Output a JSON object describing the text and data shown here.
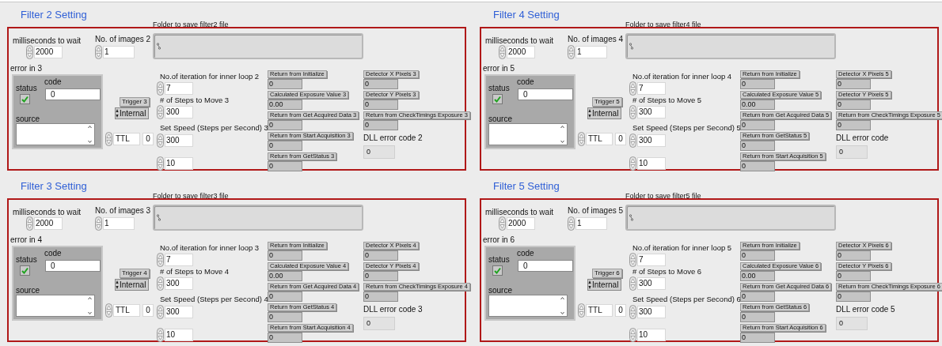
{
  "panels": [
    {
      "title": "Filter 2 Setting",
      "folder": {
        "label": "Folder to save filter2 file"
      },
      "wait": {
        "label": "milliseconds to wait",
        "value": "2000"
      },
      "images": {
        "label": "No. of images 2",
        "value": "1"
      },
      "error": {
        "label": "error in 3",
        "status_label": "status",
        "status": true,
        "code_label": "code",
        "code": "0",
        "source_label": "source"
      },
      "trigger": {
        "label": "Trigger 3",
        "value": "Internal"
      },
      "ttl": {
        "value": "TTL",
        "number": "0"
      },
      "iterations": {
        "label": "No.of iteration for inner loop 2",
        "value": "7"
      },
      "steps": {
        "label": "# of Steps to Move 3",
        "value": "300"
      },
      "speed": {
        "label": "Set Speed (Steps per Second) 3",
        "value": "300"
      },
      "extra": {
        "value": "10"
      },
      "indicators_left": [
        {
          "label": "Return from Initialize",
          "value": "0"
        },
        {
          "label": "Calculated Exposure Value 3",
          "value": "0.00"
        },
        {
          "label": "Return  from Get Acquired Data 3",
          "value": "0"
        },
        {
          "label": "Return from Start Acquisition 3",
          "value": "0"
        },
        {
          "label": "Return from GetStatus 3",
          "value": "0"
        }
      ],
      "indicators_right": [
        {
          "kind": "tag",
          "label": "Detector X Pixels 3",
          "value": "0"
        },
        {
          "kind": "tag",
          "label": "Detector Y Pixels 3",
          "value": "0"
        },
        {
          "kind": "tag",
          "label": "Return from CheckTimings Exposure 3",
          "value": "0"
        },
        {
          "kind": "plain",
          "label": "DLL error code 2",
          "value": "0"
        }
      ]
    },
    {
      "title": "Filter 3 Setting",
      "folder": {
        "label": "Folder to save filter3 file"
      },
      "wait": {
        "label": "milliseconds to wait",
        "value": "2000"
      },
      "images": {
        "label": "No. of images 3",
        "value": "1"
      },
      "error": {
        "label": "error in 4",
        "status_label": "status",
        "status": true,
        "code_label": "code",
        "code": "0",
        "source_label": "source"
      },
      "trigger": {
        "label": "Trigger 4",
        "value": "Internal"
      },
      "ttl": {
        "value": "TTL",
        "number": "0"
      },
      "iterations": {
        "label": "No.of iteration for inner loop 3",
        "value": "7"
      },
      "steps": {
        "label": "# of Steps to Move 4",
        "value": "300"
      },
      "speed": {
        "label": "Set Speed (Steps per Second) 4",
        "value": "300"
      },
      "extra": {
        "value": "10"
      },
      "indicators_left": [
        {
          "label": "Return from Initialize",
          "value": "0"
        },
        {
          "label": "Calculated Exposure Value 4",
          "value": "0.00"
        },
        {
          "label": "Return  from Get Acquired Data 4",
          "value": "0"
        },
        {
          "label": "Return from GetStatus 4",
          "value": "0"
        },
        {
          "label": "Return from Start Acquisition 4",
          "value": "0"
        }
      ],
      "indicators_right": [
        {
          "kind": "tag",
          "label": "Detector X Pixels 4",
          "value": "0"
        },
        {
          "kind": "tag",
          "label": "Detector Y Pixels 4",
          "value": "0"
        },
        {
          "kind": "tag",
          "label": "Return from CheckTimings Exposure 4",
          "value": "0"
        },
        {
          "kind": "plain",
          "label": "DLL error code 3",
          "value": "0"
        }
      ]
    },
    {
      "title": "Filter 4 Setting",
      "folder": {
        "label": "Folder to save filter4 file"
      },
      "wait": {
        "label": "milliseconds to wait",
        "value": "2000"
      },
      "images": {
        "label": "No. of images 4",
        "value": "1"
      },
      "error": {
        "label": "error in 5",
        "status_label": "status",
        "status": true,
        "code_label": "code",
        "code": "0",
        "source_label": "source"
      },
      "trigger": {
        "label": "Trigger 5",
        "value": "Internal"
      },
      "ttl": {
        "value": "TTL",
        "number": "0"
      },
      "iterations": {
        "label": "No.of iteration for inner loop 4",
        "value": "7"
      },
      "steps": {
        "label": "# of Steps to Move 5",
        "value": "300"
      },
      "speed": {
        "label": "Set Speed (Steps per Second) 5",
        "value": "300"
      },
      "extra": {
        "value": "10"
      },
      "indicators_left": [
        {
          "label": "Return from Initialize",
          "value": "0"
        },
        {
          "label": "Calculated Exposure Value 5",
          "value": "0.00"
        },
        {
          "label": "Return  from Get Acquired Data 5",
          "value": "0"
        },
        {
          "label": "Return from GetStatus 5",
          "value": "0"
        },
        {
          "label": "Return from Start Acquisition 5",
          "value": "0"
        }
      ],
      "indicators_right": [
        {
          "kind": "tag",
          "label": "Detector X Pixels 5",
          "value": "0"
        },
        {
          "kind": "tag",
          "label": "Detector Y Pixels 5",
          "value": "0"
        },
        {
          "kind": "tag",
          "label": "Return from CheckTimings Exposure 5",
          "value": "0"
        },
        {
          "kind": "plain",
          "label": "DLL error code",
          "value": "0"
        }
      ]
    },
    {
      "title": "Filter 5 Setting",
      "folder": {
        "label": "Folder to save filter5 file"
      },
      "wait": {
        "label": "milliseconds to wait",
        "value": "2000"
      },
      "images": {
        "label": "No. of images 5",
        "value": "1"
      },
      "error": {
        "label": "error in 6",
        "status_label": "status",
        "status": true,
        "code_label": "code",
        "code": "0",
        "source_label": "source"
      },
      "trigger": {
        "label": "Trigger 6",
        "value": "Internal"
      },
      "ttl": {
        "value": "TTL",
        "number": "0"
      },
      "iterations": {
        "label": "No.of iteration for inner loop 5",
        "value": "7"
      },
      "steps": {
        "label": "# of Steps to Move 6",
        "value": "300"
      },
      "speed": {
        "label": "Set Speed (Steps per Second) 6",
        "value": "300"
      },
      "extra": {
        "value": "10"
      },
      "indicators_left": [
        {
          "label": "Return from Initialize",
          "value": "0"
        },
        {
          "label": "Calculated Exposure Value 6",
          "value": "0.00"
        },
        {
          "label": "Return  from Get Acquired Data 6",
          "value": "0"
        },
        {
          "label": "Return from GetStatus 6",
          "value": "0"
        },
        {
          "label": "Return from Start Acquisition 6",
          "value": "0"
        }
      ],
      "indicators_right": [
        {
          "kind": "tag",
          "label": "Detector X Pixels 6",
          "value": "0"
        },
        {
          "kind": "tag",
          "label": "Detector Y Pixels 6",
          "value": "0"
        },
        {
          "kind": "tag",
          "label": "Return from CheckTimings Exposure 6",
          "value": "0"
        },
        {
          "kind": "plain",
          "label": "DLL error code 5",
          "value": "0"
        }
      ]
    }
  ]
}
